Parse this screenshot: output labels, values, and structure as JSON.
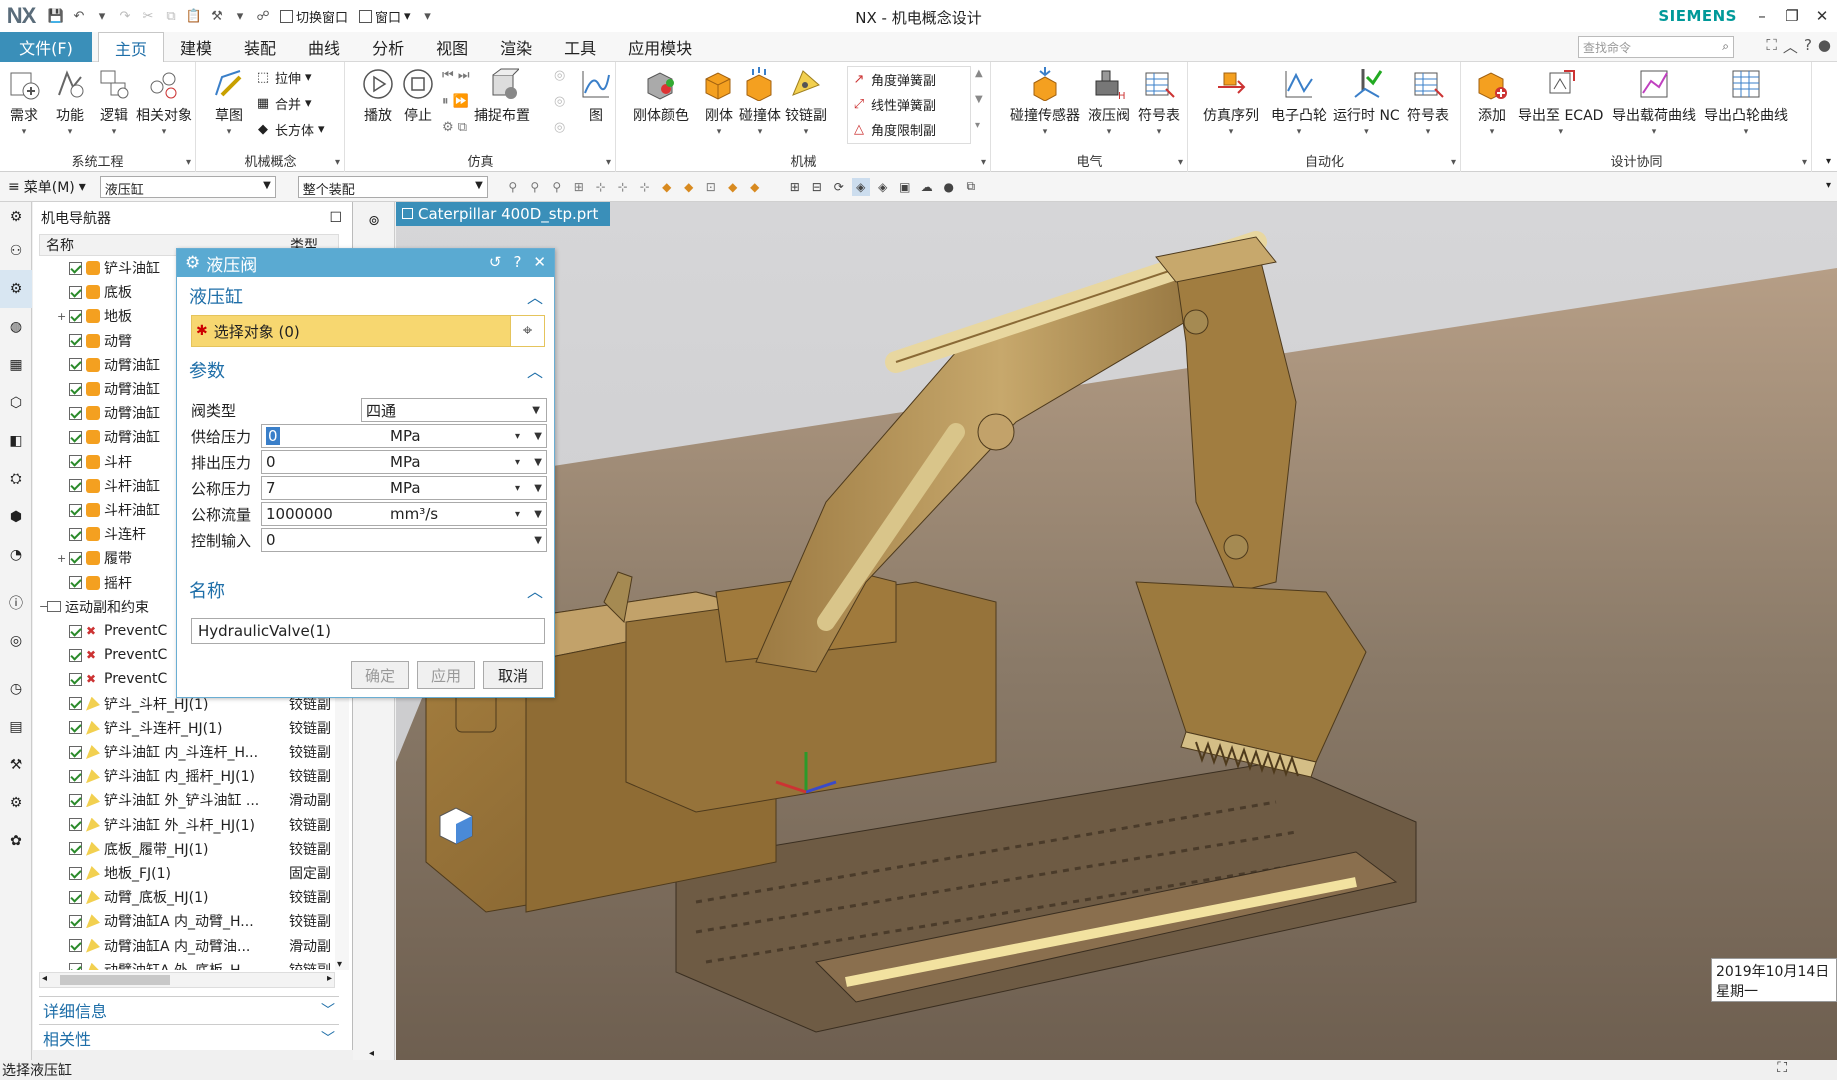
{
  "app": {
    "logo": "NX",
    "title": "NX - 机电概念设计",
    "brand": "SIEMENS",
    "switch_window": "切换窗口",
    "window_menu": "窗口"
  },
  "menu": {
    "file": "文件(F)",
    "tabs": [
      "主页",
      "建模",
      "装配",
      "曲线",
      "分析",
      "视图",
      "渲染",
      "工具",
      "应用模块"
    ],
    "active_tab": "主页",
    "search_placeholder": "查找命令"
  },
  "ribbon": {
    "groups": [
      {
        "label": "系统工程",
        "buttons": [
          "需求",
          "功能",
          "逻辑",
          "相关对象"
        ]
      },
      {
        "label": "机械概念",
        "buttons": [
          "草图"
        ],
        "small": [
          "拉伸",
          "合并",
          "长方体"
        ]
      },
      {
        "label": "仿真",
        "buttons": [
          "播放",
          "停止",
          "捕捉布置",
          "图"
        ]
      },
      {
        "label": "机械",
        "buttons": [
          "刚体颜色",
          "刚体",
          "碰撞体",
          "铰链副"
        ],
        "small": [
          "角度弹簧副",
          "线性弹簧副",
          "角度限制副"
        ]
      },
      {
        "label": "电气",
        "buttons": [
          "碰撞传感器",
          "液压阀",
          "符号表"
        ]
      },
      {
        "label": "自动化",
        "buttons": [
          "仿真序列",
          "电子凸轮",
          "运行时 NC",
          "符号表"
        ]
      },
      {
        "label": "设计协同",
        "buttons": [
          "添加",
          "导出至 ECAD",
          "导出载荷曲线",
          "导出凸轮曲线"
        ]
      }
    ]
  },
  "selection_bar": {
    "menu": "菜单(M)",
    "filter": "液压缸",
    "scope": "整个装配"
  },
  "navigator": {
    "title": "机电导航器",
    "col_name": "名称",
    "col_type": "类型",
    "rows": [
      {
        "label": "铲斗油缸",
        "type": "",
        "exp": ""
      },
      {
        "label": "底板",
        "type": "",
        "exp": ""
      },
      {
        "label": "地板",
        "type": "",
        "exp": "+"
      },
      {
        "label": "动臂",
        "type": "",
        "exp": ""
      },
      {
        "label": "动臂油缸",
        "type": "",
        "exp": ""
      },
      {
        "label": "动臂油缸",
        "type": "",
        "exp": ""
      },
      {
        "label": "动臂油缸",
        "type": "",
        "exp": ""
      },
      {
        "label": "动臂油缸",
        "type": "",
        "exp": ""
      },
      {
        "label": "斗杆",
        "type": "",
        "exp": ""
      },
      {
        "label": "斗杆油缸",
        "type": "",
        "exp": ""
      },
      {
        "label": "斗杆油缸",
        "type": "",
        "exp": ""
      },
      {
        "label": "斗连杆",
        "type": "",
        "exp": ""
      },
      {
        "label": "履带",
        "type": "",
        "exp": "+"
      },
      {
        "label": "摇杆",
        "type": "",
        "exp": ""
      },
      {
        "label": "运动副和约束",
        "type": "",
        "exp": "-"
      },
      {
        "label": "PreventC",
        "type": "",
        "exp": ""
      },
      {
        "label": "PreventC",
        "type": "",
        "exp": ""
      },
      {
        "label": "PreventC",
        "type": "",
        "exp": ""
      },
      {
        "label": "铲斗_斗杆_HJ(1)",
        "type": "铰链副",
        "exp": ""
      },
      {
        "label": "铲斗_斗连杆_HJ(1)",
        "type": "铰链副",
        "exp": ""
      },
      {
        "label": "铲斗油缸 内_斗连杆_H...",
        "type": "铰链副",
        "exp": ""
      },
      {
        "label": "铲斗油缸 内_摇杆_HJ(1)",
        "type": "铰链副",
        "exp": ""
      },
      {
        "label": "铲斗油缸 外_铲斗油缸 ...",
        "type": "滑动副",
        "exp": ""
      },
      {
        "label": "铲斗油缸 外_斗杆_HJ(1)",
        "type": "铰链副",
        "exp": ""
      },
      {
        "label": "底板_履带_HJ(1)",
        "type": "铰链副",
        "exp": ""
      },
      {
        "label": "地板_FJ(1)",
        "type": "固定副",
        "exp": ""
      },
      {
        "label": "动臂_底板_HJ(1)",
        "type": "铰链副",
        "exp": ""
      },
      {
        "label": "动臂油缸A 内_动臂_H...",
        "type": "铰链副",
        "exp": ""
      },
      {
        "label": "动臂油缸A 内_动臂油...",
        "type": "滑动副",
        "exp": ""
      },
      {
        "label": "动臂油缸A 外_底板_H...",
        "type": "铰链副",
        "exp": ""
      }
    ],
    "details": "详细信息",
    "dependencies": "相关性"
  },
  "viewport": {
    "tab": "Caterpillar 400D_stp.prt",
    "date": "2019年10月14日",
    "weekday": "星期一"
  },
  "dialog": {
    "title": "液压阀",
    "section_cylinder": "液压缸",
    "select_object": "选择对象 (0)",
    "section_params": "参数",
    "valve_type_label": "阀类型",
    "valve_type": "四通",
    "params": [
      {
        "label": "供给压力",
        "value": "0",
        "unit": "MPa"
      },
      {
        "label": "排出压力",
        "value": "0",
        "unit": "MPa"
      },
      {
        "label": "公称压力",
        "value": "7",
        "unit": "MPa"
      },
      {
        "label": "公称流量",
        "value": "1000000",
        "unit": "mm³/s"
      }
    ],
    "control_label": "控制输入",
    "control_value": "0",
    "section_name": "名称",
    "name_value": "HydraulicValve(1)",
    "ok": "确定",
    "apply": "应用",
    "cancel": "取消"
  },
  "status": {
    "text": "选择液压缸"
  },
  "colors": {
    "accent": "#3a8fb9",
    "dialog_title": "#5aaad2",
    "select_highlight": "#f7d770",
    "brand": "#009999",
    "model": "#a87f3e"
  }
}
